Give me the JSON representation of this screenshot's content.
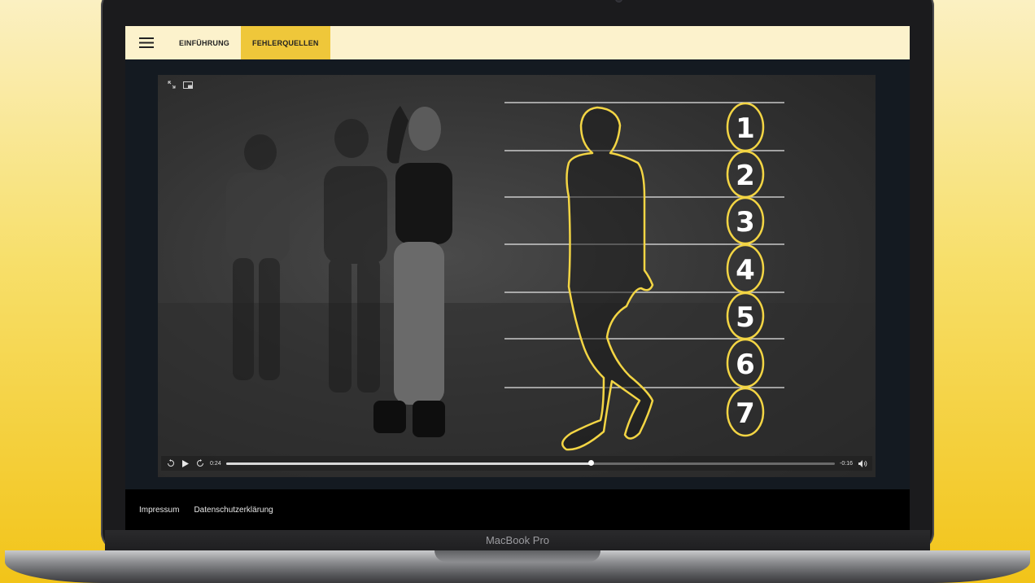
{
  "nav": {
    "menu_icon": "hamburger-icon",
    "tabs": [
      {
        "label": "EINFÜHRUNG",
        "active": false
      },
      {
        "label": "FEHLERQUELLEN",
        "active": true
      }
    ]
  },
  "video": {
    "section_numbers": [
      "1",
      "2",
      "3",
      "4",
      "5",
      "6",
      "7"
    ],
    "time_elapsed": "0:24",
    "time_remaining": "-0:16",
    "progress_fraction": 0.6,
    "controls": {
      "rewind_icon": "replay-10-icon",
      "play_icon": "play-icon",
      "forward_icon": "forward-10-icon",
      "volume_icon": "volume-icon",
      "fullscreen_icon": "expand-icon",
      "pip_icon": "picture-in-picture-icon"
    }
  },
  "footer": {
    "links": [
      "Impressum",
      "Datenschutzerklärung"
    ]
  },
  "device": {
    "brand": "MacBook Pro"
  },
  "colors": {
    "accent_yellow": "#efc73a",
    "topbar_bg": "#fcf2cc",
    "outline_yellow": "#f3d544",
    "background_yellow": "#f2c419"
  }
}
